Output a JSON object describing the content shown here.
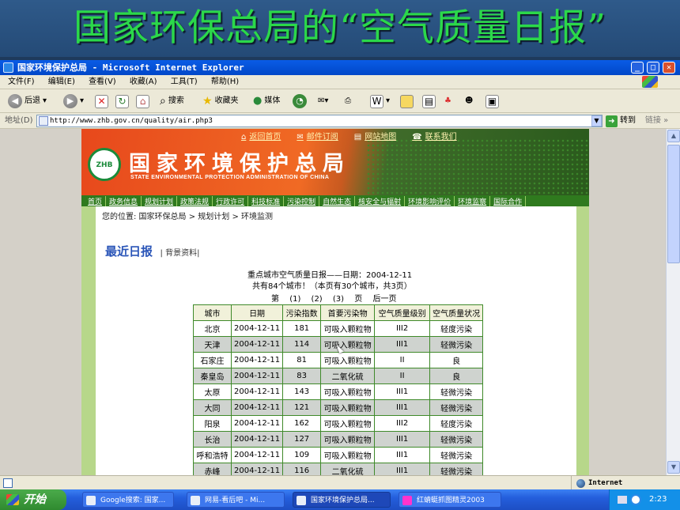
{
  "slide": {
    "title": "国家环保总局的“空气质量日报”"
  },
  "window": {
    "title": "国家环境保护总局 - Microsoft Internet Explorer",
    "menu": [
      "文件(F)",
      "编辑(E)",
      "查看(V)",
      "收藏(A)",
      "工具(T)",
      "帮助(H)"
    ],
    "toolbar": {
      "back": "后退",
      "search": "搜索",
      "favorites": "收藏夹",
      "media": "媒体"
    },
    "address_label": "地址(D)",
    "address": "http://www.zhb.gov.cn/quality/air.php3",
    "go": "转到",
    "links": "链接",
    "status_zone": "Internet"
  },
  "site": {
    "top_nav": [
      "返回首页",
      "邮件订阅",
      "网站地图",
      "联系我们"
    ],
    "name": "国家环境保护总局",
    "name_en": "STATE ENVIRONMENTAL PROTECTION ADMINISTRATION OF CHINA",
    "logo_text": "ZHB",
    "main_nav": [
      "首页",
      "政务信息",
      "规划计划",
      "政策法规",
      "行政许可",
      "科技标准",
      "污染控制",
      "自然生态",
      "核安全与辐射",
      "环境影响评价",
      "环境监察",
      "国际合作"
    ],
    "breadcrumb": "您的位置: 国家环保总局 > 规划计划 > 环境监测",
    "heading": "最近日报",
    "heading_sub": "| 背景资料|",
    "report_title": "重点城市空气质量日报——日期：2004-12-11",
    "report_count": "共有84个城市！（本页有30个城市，共3页）",
    "pager": [
      "第",
      "(1)",
      "(2)",
      "(3)",
      "页",
      "后一页"
    ]
  },
  "table": {
    "headers": [
      "城市",
      "日期",
      "污染指数",
      "首要污染物",
      "空气质量级别",
      "空气质量状况"
    ],
    "rows": [
      [
        "北京",
        "2004-12-11",
        "181",
        "可吸入颗粒物",
        "III2",
        "轻度污染"
      ],
      [
        "天津",
        "2004-12-11",
        "114",
        "可吸入颗粒物",
        "III1",
        "轻微污染"
      ],
      [
        "石家庄",
        "2004-12-11",
        "81",
        "可吸入颗粒物",
        "II",
        "良"
      ],
      [
        "秦皇岛",
        "2004-12-11",
        "83",
        "二氧化硫",
        "II",
        "良"
      ],
      [
        "太原",
        "2004-12-11",
        "143",
        "可吸入颗粒物",
        "III1",
        "轻微污染"
      ],
      [
        "大同",
        "2004-12-11",
        "121",
        "可吸入颗粒物",
        "III1",
        "轻微污染"
      ],
      [
        "阳泉",
        "2004-12-11",
        "162",
        "可吸入颗粒物",
        "III2",
        "轻度污染"
      ],
      [
        "长治",
        "2004-12-11",
        "127",
        "可吸入颗粒物",
        "III1",
        "轻微污染"
      ],
      [
        "呼和浩特",
        "2004-12-11",
        "109",
        "可吸入颗粒物",
        "III1",
        "轻微污染"
      ],
      [
        "赤峰",
        "2004-12-11",
        "116",
        "二氧化硫",
        "III1",
        "轻微污染"
      ]
    ]
  },
  "taskbar": {
    "start": "开始",
    "tasks": [
      "Google搜索: 国家...",
      "网易-看后吧 - Mi...",
      "国家环境保护总局...",
      "红蜻蜓抓图精灵2003"
    ],
    "clock": "2:23"
  }
}
